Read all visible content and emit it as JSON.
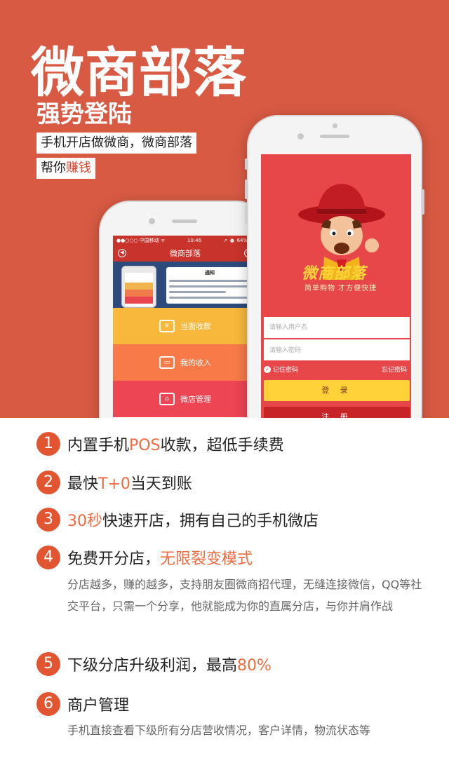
{
  "hero": {
    "title": "微商部落",
    "subtitle": "强势登陆",
    "tagline1": "手机开店做微商，微商部落",
    "tagline2_prefix": "帮你",
    "tagline2_highlight": "赚钱",
    "background_color": "#d85a43"
  },
  "left_phone": {
    "status_carrier": "●●○○○ 中国移动 ᯤ",
    "status_time": "10:46",
    "status_battery": "➚ ⏰ 64% ▭",
    "nav_title": "微商部落",
    "banner_notice_title": "通知",
    "menu": [
      {
        "label": "当面收款",
        "color": "#f8b83c"
      },
      {
        "label": "我的收入",
        "color": "#f77a48"
      },
      {
        "label": "微店管理",
        "color": "#ed4554"
      }
    ]
  },
  "right_phone": {
    "logo_text": "微商部落",
    "slogan": "简单购物 才方便快捷",
    "username_placeholder": "请输入用户名",
    "password_placeholder": "请输入密码",
    "remember_label": "记住密码",
    "forgot_label": "忘记密码",
    "login_label": "登 录",
    "register_label": "注 册"
  },
  "features": [
    {
      "num": "1",
      "before": "内置手机",
      "highlight": "POS",
      "after": "收款，超低手续费",
      "desc": ""
    },
    {
      "num": "2",
      "before": "最快",
      "highlight": "T+0",
      "after": "当天到账",
      "desc": ""
    },
    {
      "num": "3",
      "before": "",
      "highlight": "30秒",
      "after": "快速开店，拥有自己的手机微店",
      "desc": ""
    },
    {
      "num": "4",
      "before": "免费开分店，",
      "highlight": "无限裂变模式",
      "after": "",
      "desc": "分店越多，赚的越多，支持朋友圈微商招代理，无缝连接微信，QQ等社交平台，只需一个分享，他就能成为你的直属分店，与你并肩作战"
    },
    {
      "num": "5",
      "before": "下级分店升级利润，最高",
      "highlight": "80%",
      "after": "",
      "desc": ""
    },
    {
      "num": "6",
      "before": "商户管理",
      "highlight": "",
      "after": "",
      "desc": "手机直接查看下级所有分店营收情况，客户详情，物流状态等"
    }
  ],
  "colors": {
    "accent": "#e25531",
    "highlight_text": "#ef6a3e"
  }
}
